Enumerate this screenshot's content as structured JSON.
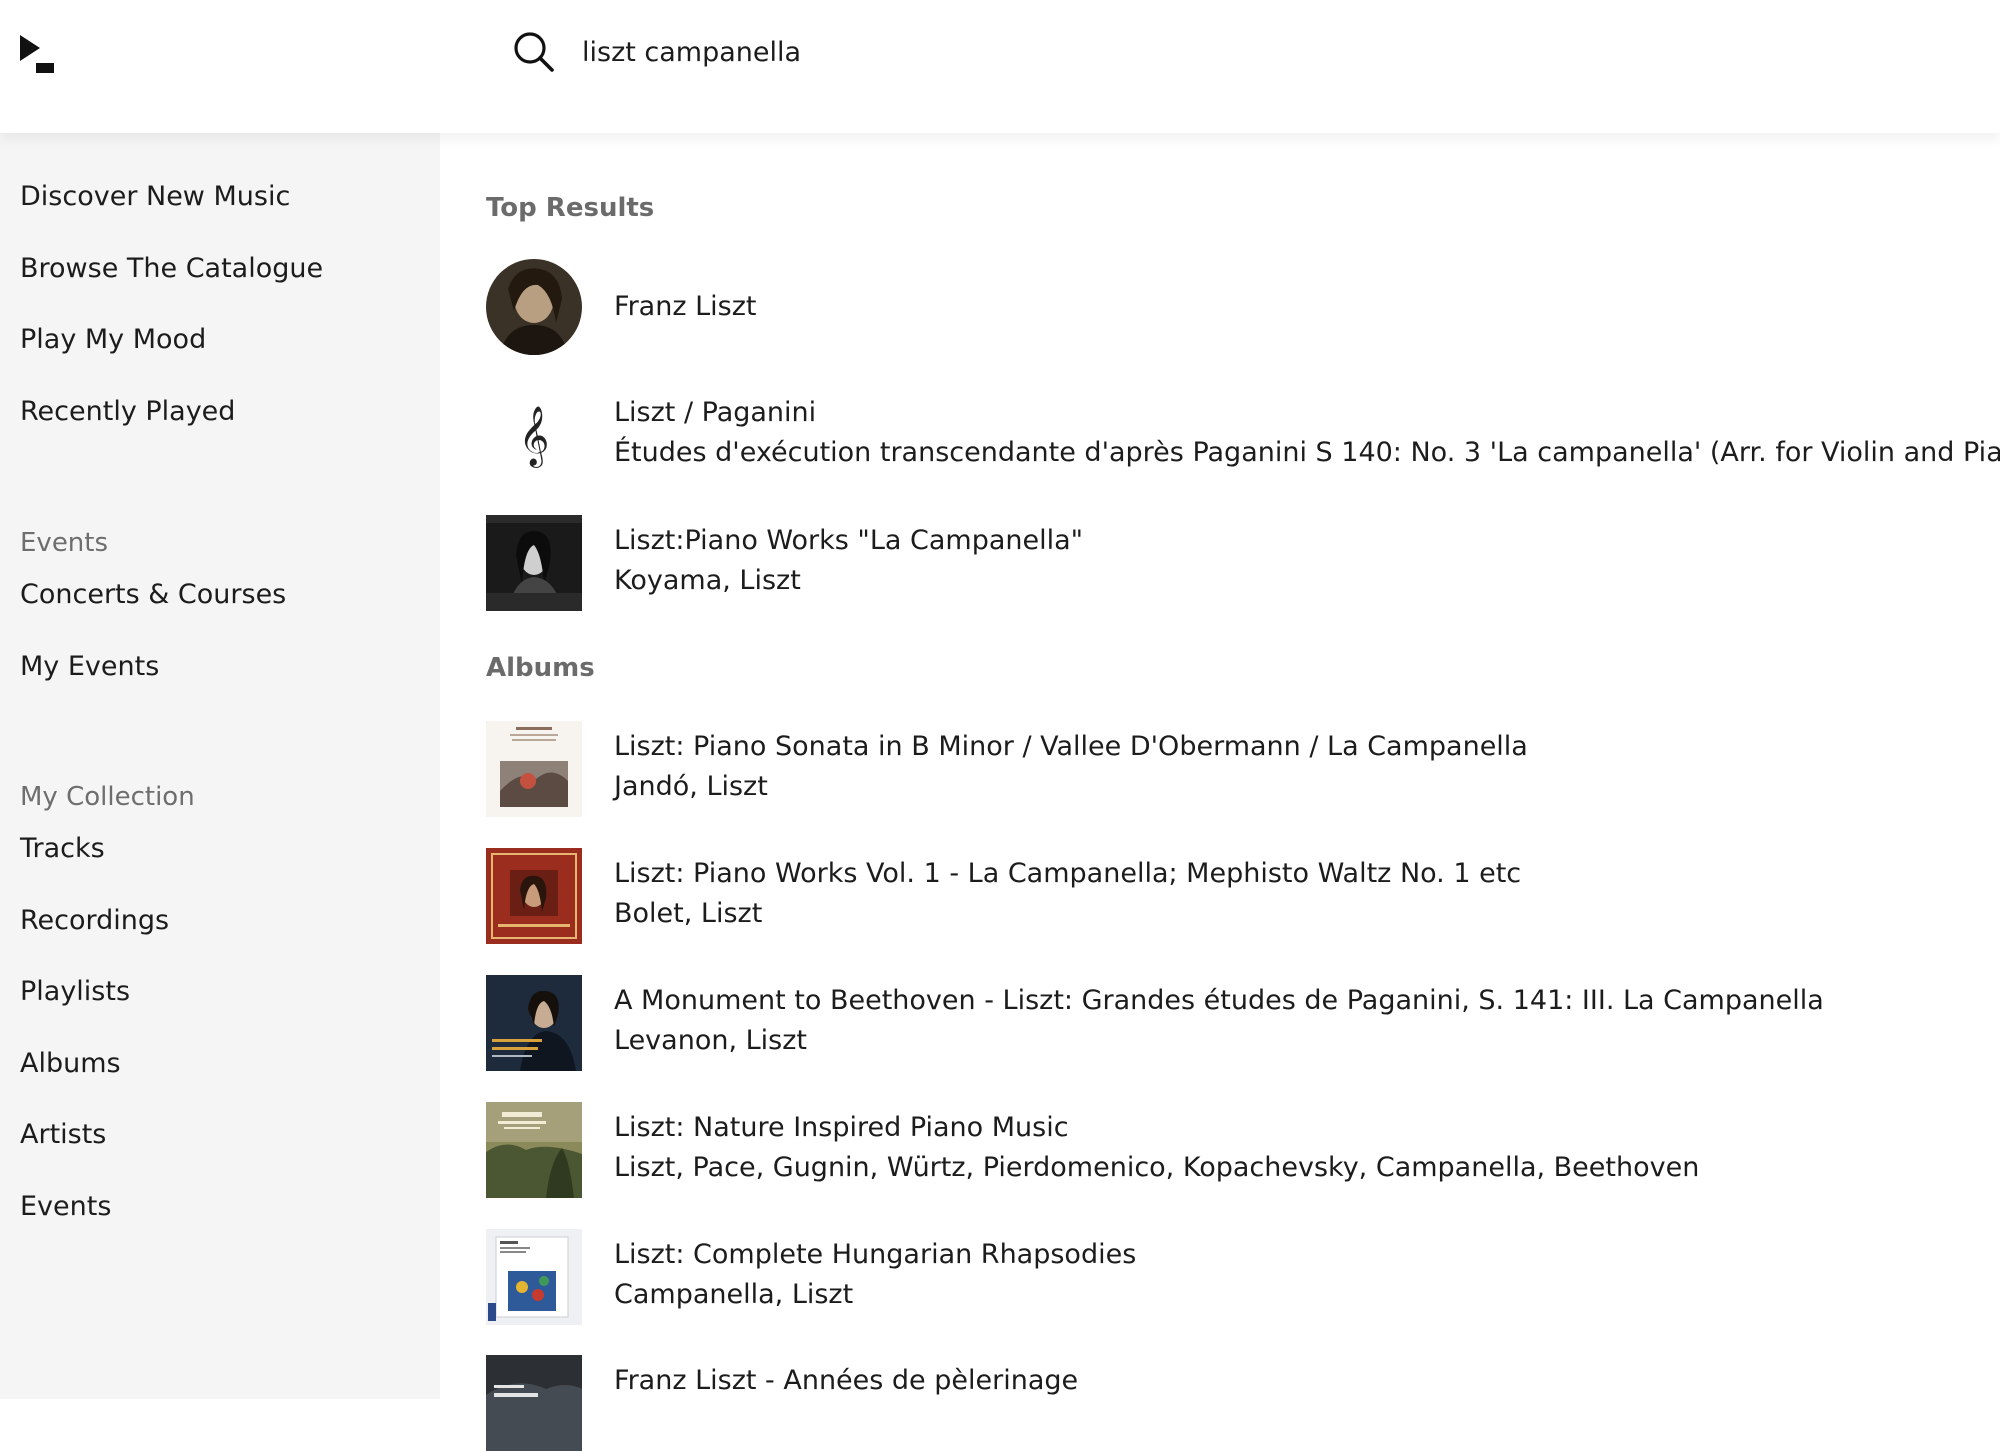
{
  "search": {
    "query": "liszt campanella"
  },
  "sidebar": {
    "items": [
      "Discover New Music",
      "Browse The Catalogue",
      "Play My Mood",
      "Recently Played"
    ],
    "events_heading": "Events",
    "events_items": [
      "Concerts & Courses",
      "My Events"
    ],
    "collection_heading": "My Collection",
    "collection_items": [
      "Tracks",
      "Recordings",
      "Playlists",
      "Albums",
      "Artists",
      "Events"
    ]
  },
  "top_results": {
    "title": "Top Results",
    "items": [
      {
        "title": "Franz Liszt",
        "icon": "artist-portrait"
      },
      {
        "title": "Liszt / Paganini",
        "subtitle": "Études d'exécution transcendante d'après Paganini S 140: No. 3 'La campanella' (Arr. for Violin and Piano)",
        "icon": "treble-clef-icon"
      },
      {
        "title": "Liszt:Piano Works \"La Campanella\"",
        "subtitle": "Koyama, Liszt",
        "icon": "album-cover"
      }
    ]
  },
  "albums": {
    "title": "Albums",
    "items": [
      {
        "title": "Liszt: Piano Sonata in B Minor / Vallee D'Obermann / La Campanella",
        "subtitle": "Jandó, Liszt"
      },
      {
        "title": "Liszt: Piano Works Vol. 1 - La Campanella; Mephisto Waltz No. 1 etc",
        "subtitle": "Bolet, Liszt"
      },
      {
        "title": "A Monument to Beethoven - Liszt: Grandes études de Paganini, S. 141: III. La Campanella",
        "subtitle": "Levanon, Liszt"
      },
      {
        "title": "Liszt: Nature Inspired Piano Music",
        "subtitle": "Liszt, Pace, Gugnin, Würtz, Pierdomenico, Kopachevsky, Campanella, Beethoven"
      },
      {
        "title": "Liszt: Complete Hungarian Rhapsodies",
        "subtitle": "Campanella, Liszt"
      },
      {
        "title": "Franz Liszt - Années de pèlerinage",
        "subtitle": ""
      }
    ]
  },
  "colors": {
    "sidebar_bg": "#f5f5f5",
    "heading_gray": "#6e6e6e",
    "text": "#1c1c1c"
  }
}
